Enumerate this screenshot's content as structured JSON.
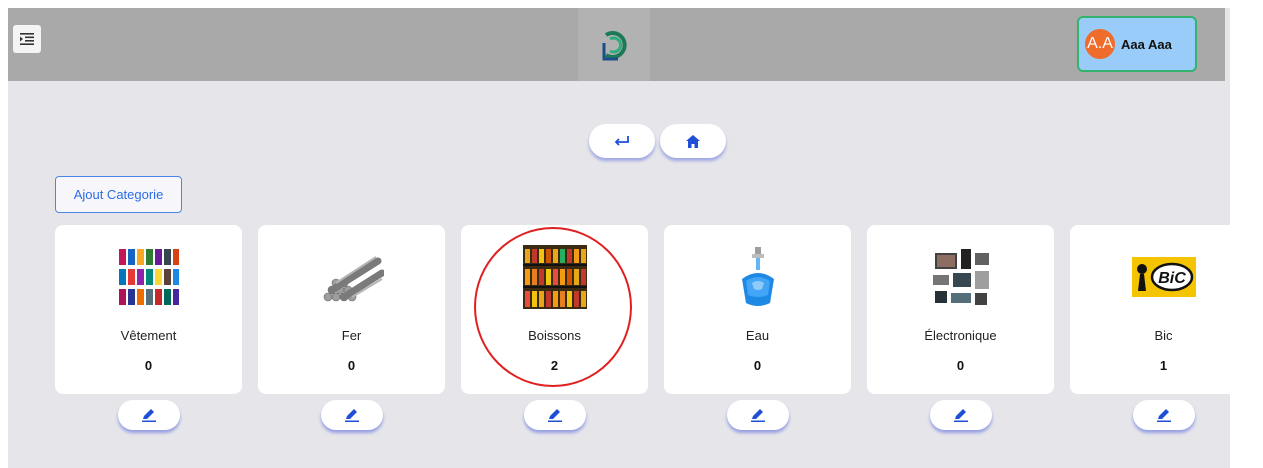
{
  "header": {
    "user": {
      "initials": "A.A",
      "name": "Aaa Aaa"
    }
  },
  "nav": {
    "back_icon": "return-arrow-icon",
    "home_icon": "home-icon"
  },
  "toolbar": {
    "add_category_label": "Ajout Categorie"
  },
  "categories": [
    {
      "name": "Vêtement",
      "count": "0",
      "icon": "clothing-image"
    },
    {
      "name": "Fer",
      "count": "0",
      "icon": "steel-rods-image"
    },
    {
      "name": "Boissons",
      "count": "2",
      "icon": "drinks-shelf-image"
    },
    {
      "name": "Eau",
      "count": "0",
      "icon": "water-faucet-image"
    },
    {
      "name": "Électronique",
      "count": "0",
      "icon": "electronics-image"
    },
    {
      "name": "Bic",
      "count": "1",
      "icon": "bic-logo-image"
    }
  ],
  "colors": {
    "header_bg": "#a9a9a9",
    "page_bg": "#e6e6ea",
    "accent": "#1f4fd6",
    "avatar": "#ef6c2b",
    "user_bg": "#99ccf8",
    "user_border": "#32b46e",
    "highlight": "#e02020"
  }
}
